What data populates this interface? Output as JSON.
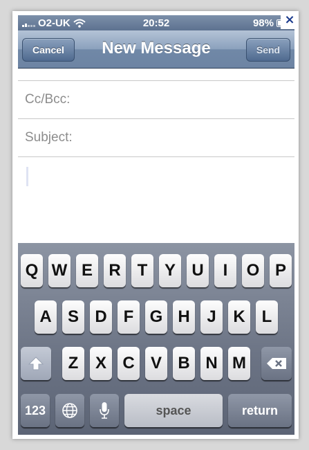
{
  "status_bar": {
    "carrier": "O2-UK",
    "time": "20:52",
    "battery": "98%"
  },
  "nav": {
    "cancel": "Cancel",
    "title": "New Message",
    "send": "Send"
  },
  "fields": {
    "cc_bcc": "Cc/Bcc:",
    "subject": "Subject:"
  },
  "keyboard": {
    "row1": [
      "Q",
      "W",
      "E",
      "R",
      "T",
      "Y",
      "U",
      "I",
      "O",
      "P"
    ],
    "row2": [
      "A",
      "S",
      "D",
      "F",
      "G",
      "H",
      "J",
      "K",
      "L"
    ],
    "row3": [
      "Z",
      "X",
      "C",
      "V",
      "B",
      "N",
      "M"
    ],
    "numbers_key": "123",
    "space_key": "space",
    "return_key": "return"
  },
  "close_label": "×",
  "icons": [
    "wifi-icon",
    "signal-icon",
    "battery-icon",
    "shift-icon",
    "backspace-icon",
    "globe-icon",
    "microphone-icon",
    "close-icon"
  ]
}
